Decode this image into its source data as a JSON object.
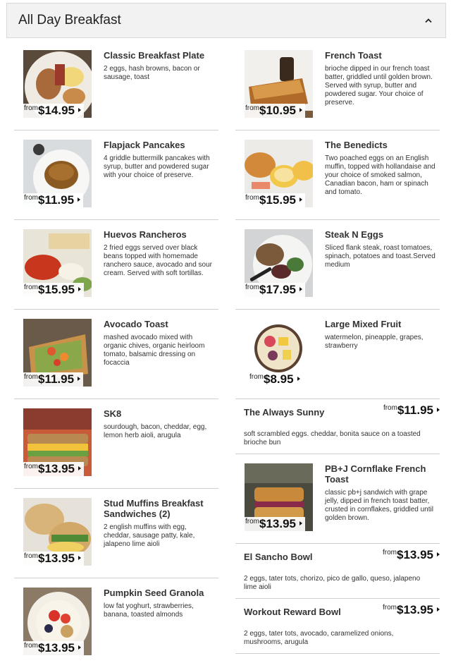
{
  "section": {
    "title": "All Day Breakfast",
    "toggle_icon": "chevron-up-icon"
  },
  "price_prefix": "from",
  "items": {
    "classic": {
      "name": "Classic Breakfast Plate",
      "desc": "2 eggs, hash browns, bacon or sausage, toast",
      "price": "$14.95"
    },
    "french": {
      "name": "French Toast",
      "desc": "brioche dipped in our french toast batter, griddled until golden brown. Served with syrup, butter and powdered sugar. Your choice of preserve.",
      "price": "$10.95"
    },
    "flapjack": {
      "name": "Flapjack Pancakes",
      "desc": "4 griddle buttermilk pancakes with syrup, butter and powdered sugar with your choice of preserve.",
      "price": "$11.95"
    },
    "benedicts": {
      "name": "The Benedicts",
      "desc": "Two poached eggs on an English muffin, topped with hollandaise and your choice of smoked salmon, Canadian bacon, ham or spinach and tomato.",
      "price": "$15.95"
    },
    "huevos": {
      "name": "Huevos Rancheros",
      "desc": "2 fried eggs served over black beans topped with homemade ranchero sauce, avocado and sour cream. Served with soft tortillas.",
      "price": "$15.95"
    },
    "steak": {
      "name": "Steak N Eggs",
      "desc": "Sliced flank steak, roast tomatoes, spinach, potatoes and toast.Served medium",
      "price": "$17.95"
    },
    "avocado": {
      "name": "Avocado Toast",
      "desc": "mashed avocado mixed with organic chives, organic heirloom tomato, balsamic dressing on focaccia",
      "price": "$11.95"
    },
    "fruit": {
      "name": "Large Mixed Fruit",
      "desc": "watermelon, pineapple, grapes, strawberry",
      "price": "$8.95"
    },
    "sk8": {
      "name": "SK8",
      "desc": "sourdough, bacon, cheddar, egg, lemon herb aioli, arugula",
      "price": "$13.95"
    },
    "sunny": {
      "name": "The Always Sunny",
      "desc": "soft scrambled eggs. cheddar, bonita sauce on a toasted brioche bun",
      "price": "$11.95"
    },
    "muffins": {
      "name": "Stud Muffins Breakfast Sandwiches (2)",
      "desc": "2 english muffins with egg, cheddar, sausage patty, kale, jalapeno lime aioli",
      "price": "$13.95"
    },
    "pbj": {
      "name": "PB+J Cornflake French Toast",
      "desc": "classic pb+j sandwich with grape jelly, dipped in french toast batter, crusted in cornflakes, griddled until golden brown.",
      "price": "$13.95"
    },
    "sancho": {
      "name": "El Sancho Bowl",
      "desc": "2 eggs, tater tots, chorizo, pico de gallo, queso, jalapeno lime aioli",
      "price": "$13.95"
    },
    "granola": {
      "name": "Pumpkin Seed Granola",
      "desc": "low fat yoghurt, strawberries, banana, toasted almonds",
      "price": "$13.95"
    },
    "workout": {
      "name": "Workout Reward Bowl",
      "desc": "2 eggs, tater tots, avocado, caramelized onions, mushrooms, arugula",
      "price": "$13.95"
    }
  }
}
